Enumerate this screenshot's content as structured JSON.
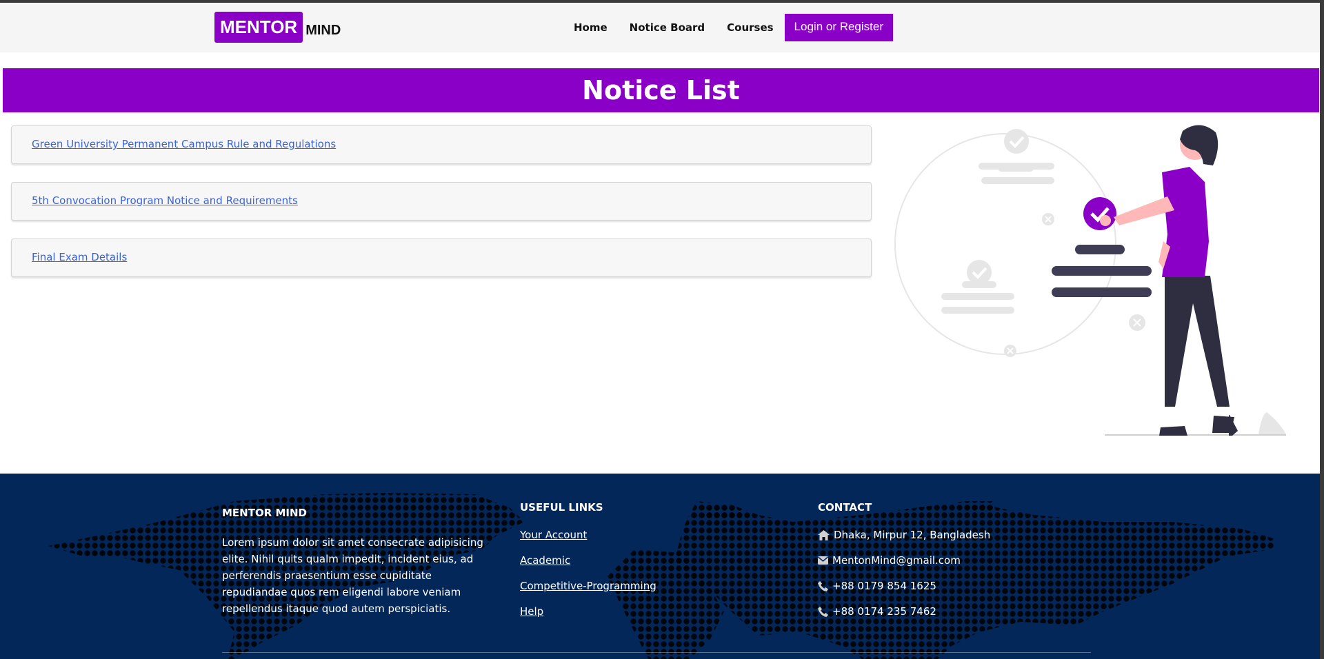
{
  "brand": {
    "logo_main": "MENTOR",
    "logo_sub": "MIND"
  },
  "nav": {
    "items": [
      "Home",
      "Notice Board",
      "Courses"
    ],
    "login_label": "Login or Register"
  },
  "page": {
    "title": "Notice List"
  },
  "notices": [
    "Green University Permanent Campus Rule and Regulations",
    "5th Convocation Program Notice and Requirements",
    "Final Exam Details"
  ],
  "footer": {
    "about": {
      "heading": "MENTOR MIND",
      "text": "Lorem ipsum dolor sit amet consecrate adipisicing elite. Nihil quits qualm impedit, incident eius, ad perferendis praesentium esse cupiditate repudiandae quos rem eligendi labore veniam repellendus itaque quod autem perspiciatis."
    },
    "links": {
      "heading": "USEFUL LINKS",
      "items": [
        "Your Account",
        "Academic",
        "Competitive-Programming",
        "Help"
      ]
    },
    "contact": {
      "heading": "CONTACT",
      "address": "Dhaka, Mirpur 12, Bangladesh",
      "email": "MentonMind@gmail.com",
      "phone1": "+88 0179 854 1625",
      "phone2": "+88 0174 235 7462",
      "icons": [
        "home-icon",
        "envelope-icon",
        "phone-icon",
        "phone-icon"
      ]
    }
  },
  "colors": {
    "accent": "#8a00c7",
    "footer_bg": "#04275a",
    "link": "#3b63d8"
  }
}
